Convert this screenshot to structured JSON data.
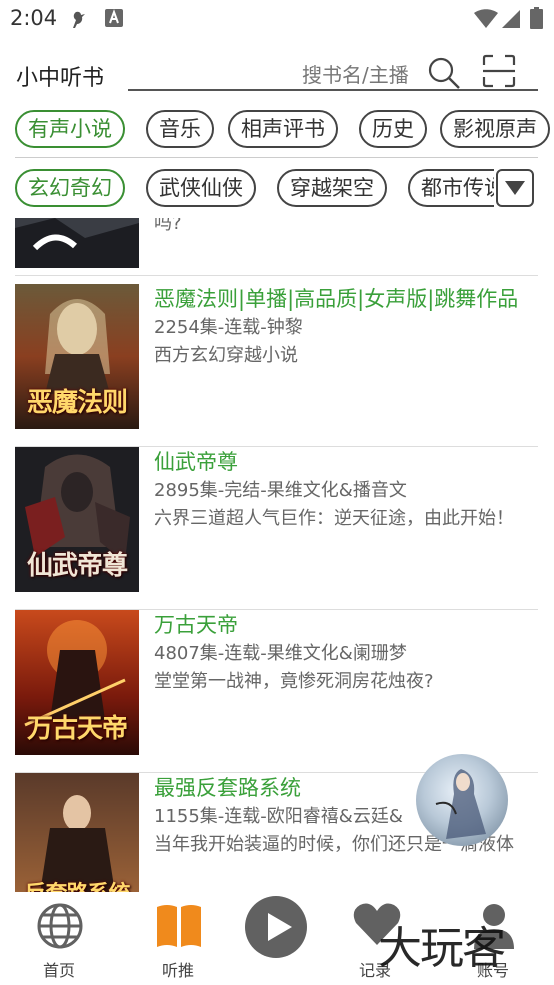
{
  "status_bar": {
    "time": "2:04"
  },
  "header": {
    "title": "小中听书",
    "search_placeholder": "搜书名/主播"
  },
  "categories": [
    "有声小说",
    "音乐",
    "相声评书",
    "历史",
    "影视原声"
  ],
  "genres": [
    "玄幻奇幻",
    "武侠仙侠",
    "穿越架空",
    "都市传说"
  ],
  "partial_item": {
    "desc_tail": "吗?"
  },
  "books": [
    {
      "title": "恶魔法则|单播|高品质|女声版|跳舞作品",
      "meta": "2254集-连载-钟黎",
      "desc": "西方玄幻穿越小说",
      "cover_text": "恶魔法则"
    },
    {
      "title": "仙武帝尊",
      "meta": "2895集-完结-果维文化&播音文",
      "desc": "六界三道超人气巨作：逆天征途，由此开始！",
      "cover_text": "仙武帝尊"
    },
    {
      "title": "万古天帝",
      "meta": "4807集-连载-果维文化&阑珊梦",
      "desc": "堂堂第一战神，竟惨死洞房花烛夜?",
      "cover_text": "万古天帝"
    },
    {
      "title": "最强反套路系统",
      "meta": "1155集-连载-欧阳睿禧&云廷&",
      "desc": "当年我开始装逼的时候，你们还只是一滴液体",
      "cover_text": "反套路系统"
    }
  ],
  "nav": {
    "home": "首页",
    "listen": "听推",
    "record": "记录",
    "account": "账号"
  },
  "watermark": "大玩客",
  "colors": {
    "accent_green": "#3aa03a",
    "nav_orange": "#f08a1c",
    "icon_gray": "#616161"
  }
}
